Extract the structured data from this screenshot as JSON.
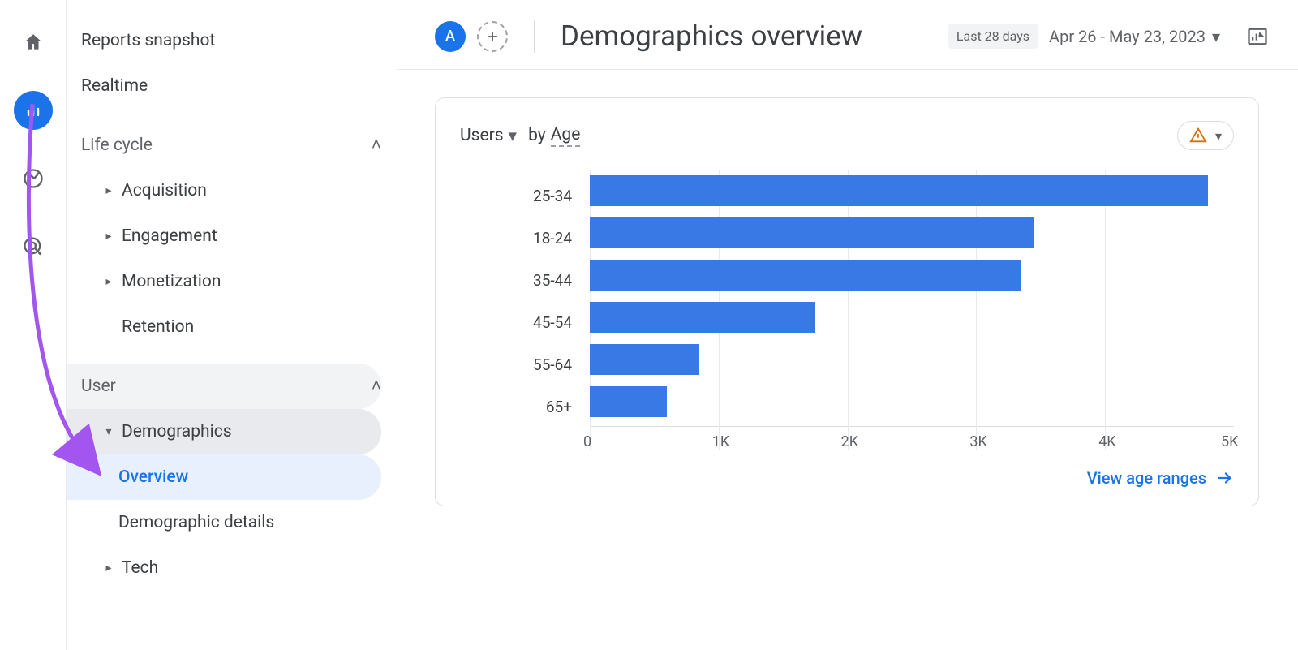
{
  "rail": {
    "account_chip": "A"
  },
  "sidebar": {
    "reports_snapshot": "Reports snapshot",
    "realtime": "Realtime",
    "lifecycle_header": "Life cycle",
    "acquisition": "Acquisition",
    "engagement": "Engagement",
    "monetization": "Monetization",
    "retention": "Retention",
    "user_header": "User",
    "demographics": "Demographics",
    "demo_overview": "Overview",
    "demo_details": "Demographic details",
    "tech": "Tech"
  },
  "header": {
    "account_letter": "A",
    "title": "Demographics overview",
    "range_badge": "Last 28 days",
    "date_range": "Apr 26 - May 23, 2023"
  },
  "card": {
    "metric": "Users",
    "by_word": "by",
    "dimension": "Age",
    "footer_link": "View age ranges"
  },
  "xaxis": [
    "0",
    "1K",
    "2K",
    "3K",
    "4K",
    "5K"
  ],
  "chart_data": {
    "type": "bar",
    "title": "Users by Age",
    "xlabel": "",
    "ylabel": "Users",
    "xlim": [
      0,
      5000
    ],
    "categories": [
      "25-34",
      "18-24",
      "35-44",
      "45-54",
      "55-64",
      "65+"
    ],
    "values": [
      4800,
      3450,
      3350,
      1750,
      850,
      600
    ]
  }
}
